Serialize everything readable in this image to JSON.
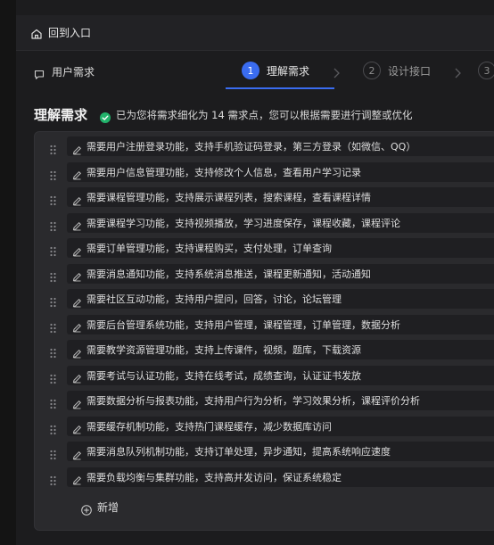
{
  "header": {
    "back_label": "回到入口"
  },
  "tabs": {
    "requirement_label": "用户需求"
  },
  "steps": [
    {
      "num": "1",
      "label": "理解需求",
      "state": "active"
    },
    {
      "num": "2",
      "label": "设计接口",
      "state": "inactive"
    },
    {
      "num": "3",
      "label": "",
      "state": "inactive"
    }
  ],
  "main": {
    "title": "理解需求",
    "status": "已为您将需求细化为 14 需求点，您可以根据需要进行调整或优化",
    "items": [
      "需要用户注册登录功能，支持手机验证码登录，第三方登录（如微信、QQ）",
      "需要用户信息管理功能，支持修改个人信息，查看用户学习记录",
      "需要课程管理功能，支持展示课程列表，搜索课程，查看课程详情",
      "需要课程学习功能，支持视频播放，学习进度保存，课程收藏，课程评论",
      "需要订单管理功能，支持课程购买，支付处理，订单查询",
      "需要消息通知功能，支持系统消息推送，课程更新通知，活动通知",
      "需要社区互动功能，支持用户提问，回答，讨论，论坛管理",
      "需要后台管理系统功能，支持用户管理，课程管理，订单管理，数据分析",
      "需要教学资源管理功能，支持上传课件，视频，题库，下载资源",
      "需要考试与认证功能，支持在线考试，成绩查询，认证证书发放",
      "需要数据分析与报表功能，支持用户行为分析，学习效果分析，课程评价分析",
      "需要缓存机制功能，支持热门课程缓存，减少数据库访问",
      "需要消息队列机制功能，支持订单处理，异步通知，提高系统响应速度",
      "需要负载均衡与集群功能，支持高并发访问，保证系统稳定"
    ],
    "add_label": "新增"
  },
  "colors": {
    "accent": "#3a6cf0",
    "success": "#22b36b"
  }
}
